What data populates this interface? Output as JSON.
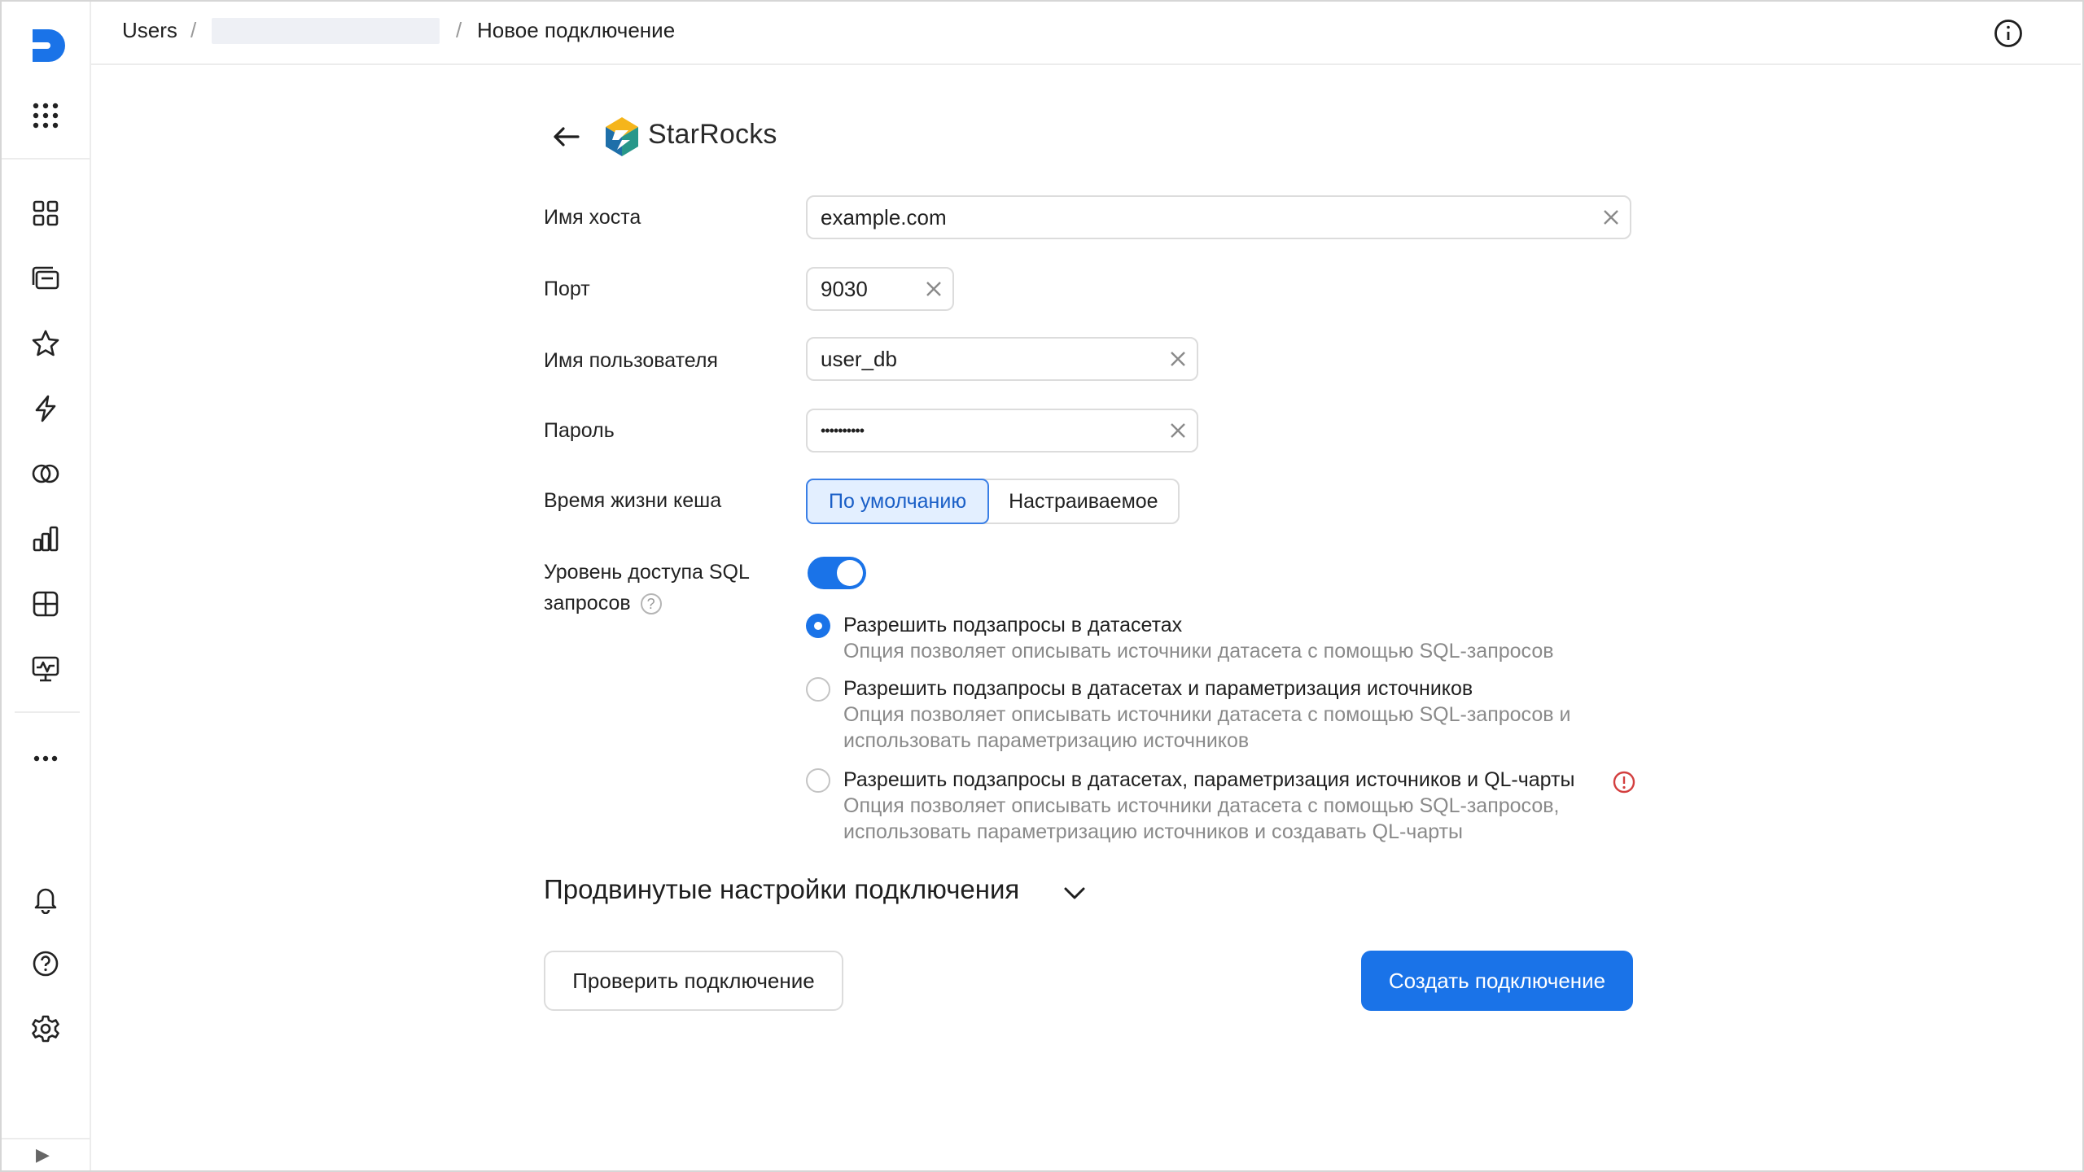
{
  "breadcrumb": {
    "root": "Users",
    "sep": "/",
    "current": "Новое подключение"
  },
  "header": {
    "info_icon": "info-circle-icon"
  },
  "sidebar": {
    "logo": "datalens-logo",
    "items": [
      {
        "name": "all-services",
        "icon": "grid-dots-icon"
      },
      {
        "name": "collections",
        "icon": "tiles-icon"
      },
      {
        "name": "workbooks",
        "icon": "folders-icon"
      },
      {
        "name": "favorites",
        "icon": "star-icon"
      },
      {
        "name": "connections",
        "icon": "bolt-icon"
      },
      {
        "name": "datasets",
        "icon": "circles-icon"
      },
      {
        "name": "charts",
        "icon": "bar-chart-icon"
      },
      {
        "name": "dashboards",
        "icon": "dashboard-icon"
      },
      {
        "name": "monitoring",
        "icon": "monitor-icon"
      },
      {
        "name": "more",
        "icon": "more-dots-icon"
      },
      {
        "name": "notifications",
        "icon": "bell-icon"
      },
      {
        "name": "help",
        "icon": "help-icon"
      },
      {
        "name": "settings",
        "icon": "gear-icon"
      }
    ],
    "collapse": "▶"
  },
  "form": {
    "title": "StarRocks",
    "host": {
      "label": "Имя хоста",
      "value": "example.com"
    },
    "port": {
      "label": "Порт",
      "value": "9030"
    },
    "user": {
      "label": "Имя пользователя",
      "value": "user_db"
    },
    "password": {
      "label": "Пароль",
      "value": "••••••••••"
    },
    "cache": {
      "label": "Время жизни кеша",
      "options": [
        "По умолчанию",
        "Настраиваемое"
      ],
      "selected": "По умолчанию"
    },
    "sql": {
      "label_line1": "Уровень доступа SQL",
      "label_line2": "запросов",
      "help": "?",
      "enabled": true,
      "options": [
        {
          "title": "Разрешить подзапросы в датасетах",
          "desc1": "Опция позволяет описывать источники датасета с помощью SQL-запросов",
          "desc2": "",
          "selected": true
        },
        {
          "title": "Разрешить подзапросы в датасетах и параметризация источников",
          "desc1": "Опция позволяет описывать источники датасета с помощью SQL-запросов и",
          "desc2": "использовать параметризацию источников",
          "selected": false
        },
        {
          "title": "Разрешить подзапросы в датасетах, параметризация источников и QL-чарты",
          "desc1": "Опция позволяет описывать источники датасета с помощью SQL-запросов,",
          "desc2": "использовать параметризацию источников и создавать QL-чарты",
          "selected": false
        }
      ]
    },
    "advanced": "Продвинутые настройки подключения",
    "check_button": "Проверить подключение",
    "create_button": "Создать подключение"
  },
  "colors": {
    "accent": "#1a73e8",
    "warning": "#d33f3f",
    "border": "#dcdcdc"
  }
}
